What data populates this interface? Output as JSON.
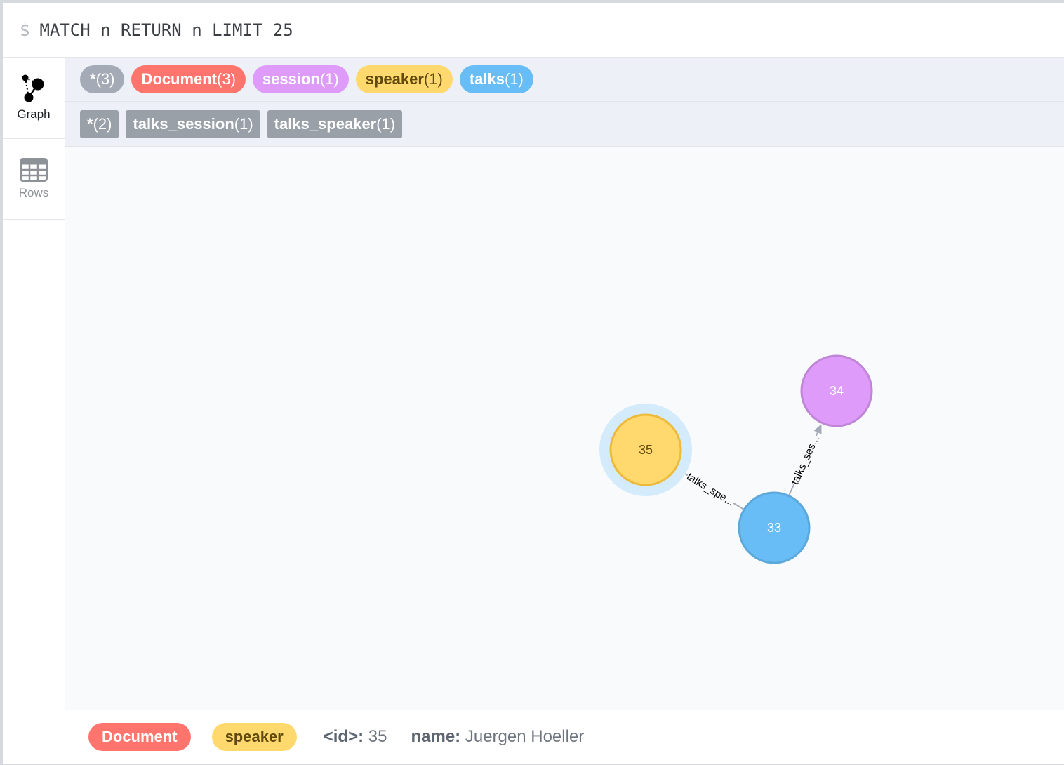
{
  "query": {
    "prompt": "$",
    "text": "MATCH n RETURN n LIMIT 25"
  },
  "tabs": [
    {
      "label": "Graph",
      "icon": "graph-icon",
      "active": true
    },
    {
      "label": "Rows",
      "icon": "table-icon",
      "active": false
    }
  ],
  "node_labels": [
    {
      "name": "*",
      "count": "(3)",
      "color": "#a5abb6",
      "text_color": "#ffffff"
    },
    {
      "name": "Document",
      "count": "(3)",
      "color": "#ff756e",
      "text_color": "#ffffff"
    },
    {
      "name": "session",
      "count": "(1)",
      "color": "#de9bf9",
      "text_color": "#ffffff"
    },
    {
      "name": "speaker",
      "count": "(1)",
      "color": "#ffd86e",
      "text_color": "#604a0e"
    },
    {
      "name": "talks",
      "count": "(1)",
      "color": "#68bdf6",
      "text_color": "#ffffff"
    }
  ],
  "relationship_types": [
    {
      "name": "*",
      "count": "(2)"
    },
    {
      "name": "talks_session",
      "count": "(1)"
    },
    {
      "name": "talks_speaker",
      "count": "(1)"
    }
  ],
  "graph": {
    "nodes": [
      {
        "id": "35",
        "label": "speaker",
        "fill": "#ffd86e",
        "stroke": "#edba39",
        "text_color": "#604a0e",
        "selected": true
      },
      {
        "id": "34",
        "label": "session",
        "fill": "#de9bf9",
        "stroke": "#bf85d6",
        "text_color": "#ffffff",
        "selected": false
      },
      {
        "id": "33",
        "label": "talks",
        "fill": "#68bdf6",
        "stroke": "#5ca8db",
        "text_color": "#ffffff",
        "selected": false
      }
    ],
    "edges": [
      {
        "from": "33",
        "to": "35",
        "caption": "talks_spe..."
      },
      {
        "from": "33",
        "to": "34",
        "caption": "talks_ses..."
      }
    ]
  },
  "selection": {
    "labels": [
      {
        "name": "Document",
        "color": "#ff756e",
        "text_color": "#ffffff"
      },
      {
        "name": "speaker",
        "color": "#ffd86e",
        "text_color": "#604a0e"
      }
    ],
    "properties": [
      {
        "key": "<id>:",
        "value": "35"
      },
      {
        "key": "name:",
        "value": "Juergen Hoeller"
      }
    ]
  }
}
